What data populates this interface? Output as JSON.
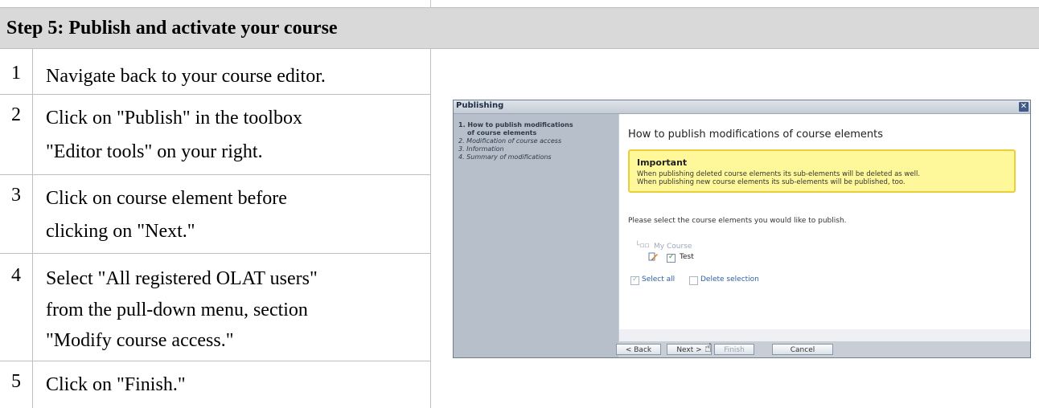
{
  "title": "Step 5: Publish and activate your course",
  "steps": [
    {
      "num": "1",
      "line1": "Navigate back to your course editor.",
      "line2": "",
      "line3": ""
    },
    {
      "num": "2",
      "line1": "Click on \"Publish\" in the toolbox",
      "line2": "\"Editor tools\" on your right.",
      "line3": ""
    },
    {
      "num": "3",
      "line1": "Click on course element before",
      "line2": "clicking on \"Next.\"",
      "line3": ""
    },
    {
      "num": "4",
      "line1": "Select \"All registered OLAT users\"",
      "line2": "from the pull-down menu, section",
      "line3": "\"Modify course access.\""
    },
    {
      "num": "5",
      "line1": "Click on \"Finish.\"",
      "line2": "",
      "line3": ""
    }
  ],
  "dialog": {
    "title": "Publishing",
    "close_icon": "close-icon",
    "wizard_steps": [
      "1. How to publish modifications",
      "of course elements",
      "2. Modification of course access",
      "3. Information",
      "4. Summary of modifications"
    ],
    "content_title": "How to publish modifications of course elements",
    "important_title": "Important",
    "important_line1": "When publishing deleted course elements its sub-elements will be deleted as well.",
    "important_line2": "When publishing new course elements its sub-elements will be published, too.",
    "select_text": "Please select the course elements you would like to publish.",
    "tree_root": "My Course",
    "tree_node": "Test",
    "tree_node_checked": true,
    "select_all": "Select all",
    "delete_selection": "Delete selection",
    "buttons": {
      "back": "< Back",
      "next": "Next >",
      "finish": "Finish",
      "cancel": "Cancel"
    },
    "cursor_icon": "hand-pointer-icon"
  },
  "colors": {
    "header_bg": "#d9d9d9",
    "dialog_frame": "#c7ced6",
    "important_bg": "#fff89a",
    "important_border": "#e9cf3a"
  }
}
